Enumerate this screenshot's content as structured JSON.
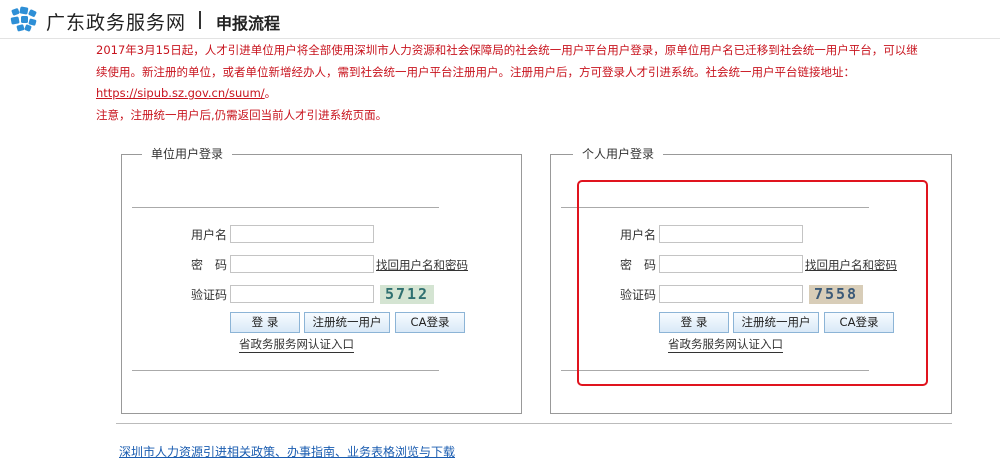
{
  "header": {
    "site_name": "广东政务服务网",
    "page_title": "申报流程"
  },
  "notice": {
    "line1": "2017年3月15日起，人才引进单位用户将全部使用深圳市人力资源和社会保障局的社会统一用户平台用户登录，原单位用户名已迁移到社会统一用户平台，可以继续使用。新注册的单位，或者单位新增经办人，需到社会统一用户平台注册用户。注册用户后，方可登录人才引进系统。社会统一用户平台链接地址：",
    "link": "https://sipub.sz.gov.cn/suum/",
    "link_suffix": "。",
    "line2": "注意，注册统一用户后,仍需返回当前人才引进系统页面。"
  },
  "unit_login": {
    "legend": "单位用户登录",
    "username_label": "用户名",
    "password_label": "密　码",
    "captcha_label": "验证码",
    "username_value": "",
    "password_value": "",
    "captcha_value": "",
    "recover_link": "找回用户名和密码",
    "captcha_text": "5712",
    "login_button": "登 录",
    "register_button": "注册统一用户",
    "ca_button": "CA登录",
    "portal_link": "省政务服务网认证入口"
  },
  "personal_login": {
    "legend": "个人用户登录",
    "username_label": "用户名",
    "password_label": "密　码",
    "captcha_label": "验证码",
    "username_value": "",
    "password_value": "",
    "captcha_value": "",
    "recover_link": "找回用户名和密码",
    "captcha_text": "7558",
    "login_button": "登 录",
    "register_button": "注册统一用户",
    "ca_button": "CA登录",
    "portal_link": "省政务服务网认证入口"
  },
  "footer": {
    "link": "深圳市人力资源引进相关政策、办事指南、业务表格浏览与下载"
  },
  "colors": {
    "notice": "#c8141e",
    "highlight_border": "#e0141e",
    "link": "#1a5cb0",
    "logo": "#2e8fd6"
  },
  "icons": {
    "logo": "guangdong-government-logo-icon"
  }
}
